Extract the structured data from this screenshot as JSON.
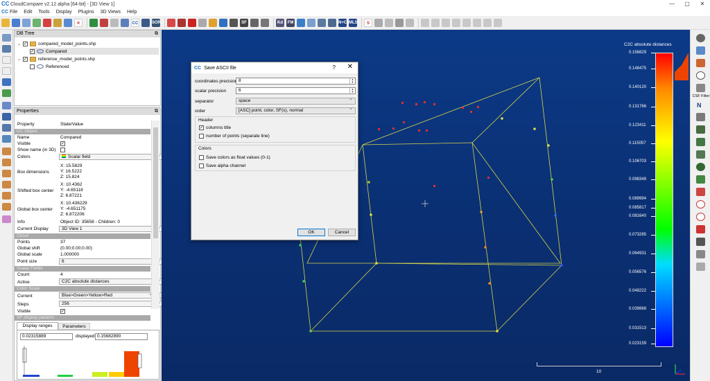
{
  "window": {
    "title": "CloudCompare v2.12 alpha [64-bit] - [3D View 1]",
    "min": "—",
    "max": "▢",
    "close": "✕",
    "logo": "CC"
  },
  "menu": [
    "File",
    "Edit",
    "Tools",
    "Display",
    "Plugins",
    "3D Views",
    "Help"
  ],
  "toolbar_text": {
    "sor": "SOR",
    "sf": "SF",
    "nc": "N+C",
    "mls": "MLS",
    "cc": "CC",
    "kd": "Kd",
    "fm": "FM"
  },
  "dbtree": {
    "title": "DB Tree",
    "float": "⧉",
    "items": [
      {
        "label": "compared_model_points.shp"
      },
      {
        "label": "Compared"
      },
      {
        "label": "reference_model_points.shp"
      },
      {
        "label": "Referenced"
      }
    ]
  },
  "properties": {
    "title": "Properties",
    "float": "⧉",
    "header": {
      "property": "Property",
      "value": "State/Value"
    },
    "cc_object": "CC Object",
    "name_k": "Name",
    "name_v": "Compared",
    "visible_k": "Visible",
    "show_name_k": "Show name (in 3D)",
    "colors_k": "Colors",
    "colors_v": "Scalar field",
    "box_dim_k": "Box dimensions",
    "box_dim_x": "X: 15.5829",
    "box_dim_y": "Y: 16.5222",
    "box_dim_z": "Z: 15.824",
    "shift_k": "Shifted box center",
    "shift_x": "X: 10.4362",
    "shift_y": "Y: -4.65118",
    "shift_z": "Z: 6.87221",
    "global_k": "Global box center",
    "global_x": "X: 10.436229",
    "global_y": "Y: -4.651175",
    "global_z": "Z: 6.872206",
    "info_k": "Info",
    "info_v": "Object ID: 35658 - Children: 0",
    "cur_display_k": "Current Display",
    "cur_display_v": "3D View 1",
    "cloud": "Cloud",
    "points_k": "Points",
    "points_v": "37",
    "gshift_k": "Global shift",
    "gshift_v": "(0.00;0.00;0.00)",
    "gscale_k": "Global scale",
    "gscale_v": "1.000000",
    "psize_k": "Point size",
    "psize_v": "6",
    "scalar_fields": "Scalar Fields",
    "count_k": "Count",
    "count_v": "4",
    "active_k": "Active",
    "active_v": "C2C absolute distances",
    "color_scale": "Color Scale",
    "current_k": "Current",
    "current_v": "Blue>Green>Yellow>Red",
    "steps_k": "Steps",
    "steps_v": "256",
    "visible2_k": "Visible",
    "sf_display": "SF display params",
    "tab_ranges": "Display ranges",
    "tab_params": "Parameters",
    "range_min": "0.02315889",
    "displayed_lbl": "displayed",
    "range_max": "0.15682890"
  },
  "dialog": {
    "title": "Save ASCII file",
    "help": "?",
    "close": "✕",
    "coord_lbl": "coordinates precision",
    "coord_v": "8",
    "scalar_lbl": "scalar precision",
    "scalar_v": "6",
    "sep_lbl": "separator",
    "sep_v": "space",
    "order_lbl": "order",
    "order_v": "[ASC] point, color, SF(s), normal",
    "header_grp": "Header",
    "col_title": "columns title",
    "num_points": "number of points (separate line)",
    "colors_grp": "Colors",
    "float_colors": "Save colors as float values (0-1)",
    "alpha": "Save alpha channel",
    "ok": "OK",
    "cancel": "Cancel"
  },
  "scale": {
    "title": "C2C absolute distances",
    "ticks": [
      "0.156829",
      "0.148475",
      "0.140120",
      "0.131766",
      "0.123411",
      "0.115057",
      "0.106703",
      "0.098348",
      "0.089994",
      "0.085817",
      "0.081640",
      "0.073285",
      "0.064931",
      "0.056576",
      "0.048222",
      "0.039868",
      "0.031513",
      "0.023159"
    ],
    "length_label": "10"
  },
  "right_toolbar": {
    "csf": "CSF Filter",
    "north": "N"
  },
  "colors": {
    "view_bg": "#0c3a87",
    "box": "#e8e84a",
    "point_red": "#e0302a",
    "accent": "#0078d7"
  }
}
